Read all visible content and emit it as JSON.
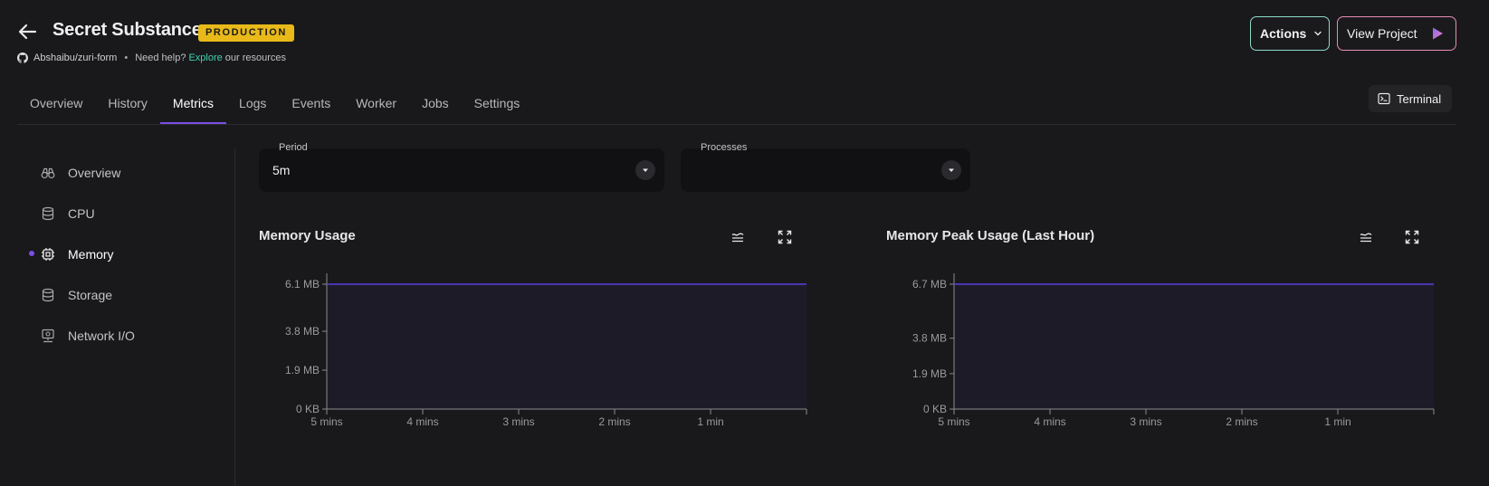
{
  "header": {
    "title": "Secret Substance",
    "badge": "PRODUCTION",
    "repo": "Abshaibu/zuri-form",
    "help_prefix": "Need help?",
    "help_link": "Explore",
    "help_suffix": "our resources",
    "actions_label": "Actions",
    "view_project_label": "View Project",
    "terminal_label": "Terminal"
  },
  "tabs": [
    {
      "label": "Overview"
    },
    {
      "label": "History"
    },
    {
      "label": "Metrics",
      "active": true
    },
    {
      "label": "Logs"
    },
    {
      "label": "Events"
    },
    {
      "label": "Worker"
    },
    {
      "label": "Jobs"
    },
    {
      "label": "Settings"
    }
  ],
  "sidebar": {
    "items": [
      {
        "label": "Overview",
        "icon": "binoculars-icon"
      },
      {
        "label": "CPU",
        "icon": "database-icon"
      },
      {
        "label": "Memory",
        "icon": "chip-icon",
        "active": true
      },
      {
        "label": "Storage",
        "icon": "database-icon"
      },
      {
        "label": "Network I/O",
        "icon": "network-icon"
      }
    ]
  },
  "filters": {
    "period_label": "Period",
    "period_value": "5m",
    "processes_label": "Processes",
    "processes_value": ""
  },
  "colors": {
    "accent": "#7a4de8",
    "badge": "#e8b919",
    "link": "#3fd0b0",
    "series": "#5a3fe0"
  },
  "charts": [
    {
      "title": "Memory Usage"
    },
    {
      "title": "Memory Peak Usage (Last Hour)"
    }
  ],
  "chart_data": [
    {
      "type": "area",
      "title": "Memory Usage",
      "x_tick_labels": [
        "5 mins",
        "4 mins",
        "3 mins",
        "2 mins",
        "1 min"
      ],
      "y_tick_labels": [
        "0 KB",
        "1.9 MB",
        "3.8 MB",
        "6.1 MB"
      ],
      "y_tick_values": [
        0,
        1.9,
        3.8,
        6.1
      ],
      "ylim": [
        0,
        6.1
      ],
      "x": [
        0,
        5
      ],
      "values": [
        6.1,
        6.1
      ],
      "unit": "MB"
    },
    {
      "type": "area",
      "title": "Memory Peak Usage (Last Hour)",
      "x_tick_labels": [
        "5 mins",
        "4 mins",
        "3 mins",
        "2 mins",
        "1 min"
      ],
      "y_tick_labels": [
        "0 KB",
        "1.9 MB",
        "3.8 MB",
        "6.7 MB"
      ],
      "y_tick_values": [
        0,
        1.9,
        3.8,
        6.7
      ],
      "ylim": [
        0,
        6.7
      ],
      "x": [
        0,
        5
      ],
      "values": [
        6.7,
        6.7
      ],
      "unit": "MB"
    }
  ]
}
